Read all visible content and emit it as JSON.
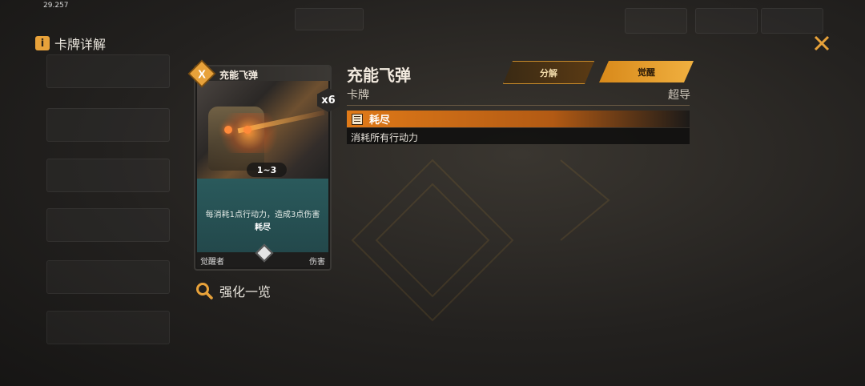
{
  "status": {
    "time": "29.257"
  },
  "header": {
    "title": "卡牌详解"
  },
  "card": {
    "name": "充能飞弹",
    "badge": "X",
    "count": "x6",
    "cost": "1~3",
    "description": "每消耗1点行动力，造成3点伤害",
    "keyword": "耗尽",
    "type_left": "觉醒者",
    "type_right": "伤害"
  },
  "detail": {
    "name": "充能飞弹",
    "type": "卡牌",
    "rarity": "超导",
    "buttons": {
      "decompose": "分解",
      "awaken": "觉醒"
    },
    "keyword": {
      "name": "耗尽",
      "description": "消耗所有行动力"
    }
  },
  "upgrade": {
    "label": "强化一览"
  },
  "colors": {
    "accent": "#e8a23a",
    "keyword_bar": "#e07a18",
    "card_desc_bg": "#2a5a5c"
  }
}
